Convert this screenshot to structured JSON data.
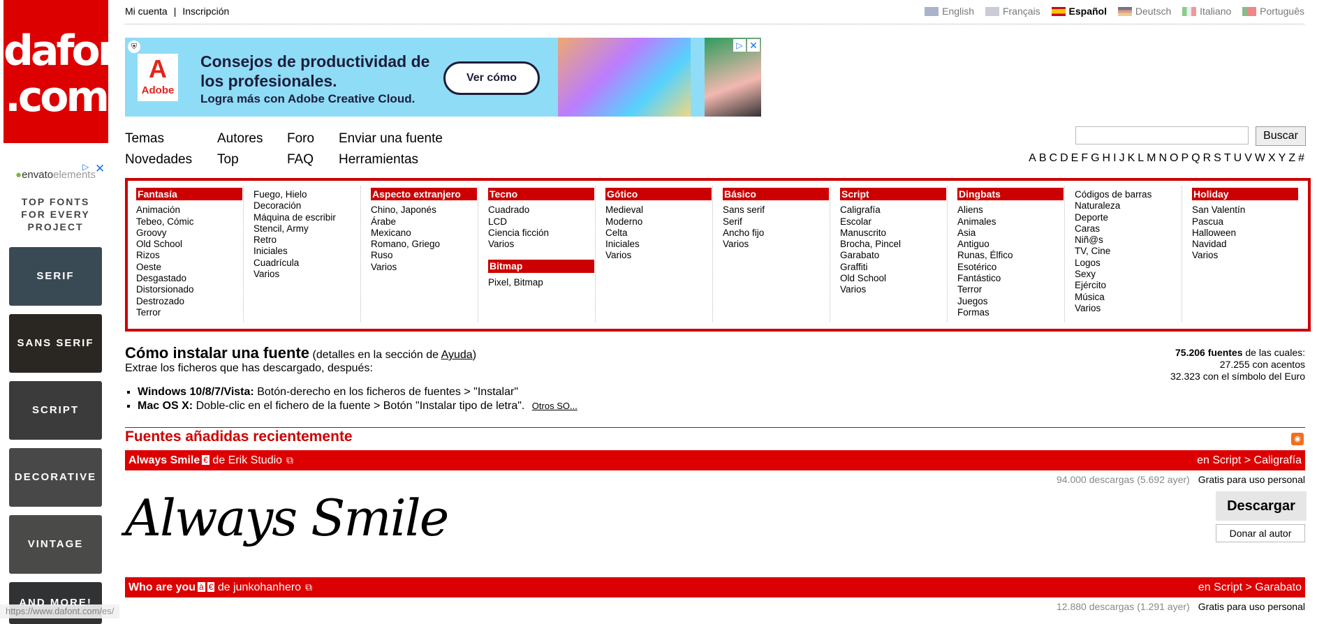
{
  "logo": {
    "line1": "dafont",
    "line2": ".com"
  },
  "envato_ad": {
    "logo_text": "envato",
    "logo_suffix": "elements",
    "tagline": "TOP FONTS FOR EVERY PROJECT",
    "tiles": [
      "SERIF",
      "SANS SERIF",
      "SCRIPT",
      "DECORATIVE",
      "VINTAGE",
      "AND MORE!"
    ],
    "close_glyph": "✕",
    "adchoice_glyph": "▷"
  },
  "toplinks": {
    "account": "Mi cuenta",
    "separator": "|",
    "signup": "Inscripción"
  },
  "languages": [
    {
      "label": "English",
      "active": false,
      "flag": "#a9b3c9"
    },
    {
      "label": "Français",
      "active": false,
      "flag": "#c9ccd6"
    },
    {
      "label": "Español",
      "active": true,
      "flag": "#c60b1e"
    },
    {
      "label": "Deutsch",
      "active": false,
      "flag": "#d9a0a0"
    },
    {
      "label": "Italiano",
      "active": false,
      "flag": "#a7cfa9"
    },
    {
      "label": "Português",
      "active": false,
      "flag": "#9fc79a"
    }
  ],
  "banner_ad": {
    "brand_letter": "A",
    "brand_name": "Adobe",
    "headline": "Consejos de productividad de los profesionales.",
    "subline": "Logra más con Adobe Creative Cloud.",
    "cta": "Ver cómo",
    "close_glyph": "✕",
    "info_glyph": "▷",
    "shield_glyph": "⛨"
  },
  "nav": {
    "themes": "Temas",
    "authors": "Autores",
    "forum": "Foro",
    "submit": "Enviar una fuente",
    "new": "Novedades",
    "top": "Top",
    "faq": "FAQ",
    "tools": "Herramientas"
  },
  "search": {
    "placeholder": "",
    "button": "Buscar"
  },
  "alphabet": [
    "A",
    "B",
    "C",
    "D",
    "E",
    "F",
    "G",
    "H",
    "I",
    "J",
    "K",
    "L",
    "M",
    "N",
    "O",
    "P",
    "Q",
    "R",
    "S",
    "T",
    "U",
    "V",
    "W",
    "X",
    "Y",
    "Z",
    "#"
  ],
  "categories": [
    {
      "head": "Fantasía",
      "items": [
        "Animación",
        "Tebeo, Cómic",
        "Groovy",
        "Old School",
        "Rizos",
        "Oeste",
        "Desgastado",
        "Distorsionado",
        "Destrozado",
        "Terror"
      ]
    },
    {
      "head": "",
      "items": [
        "Fuego, Hielo",
        "Decoración",
        "Máquina de escribir",
        "Stencil, Army",
        "Retro",
        "Iniciales",
        "Cuadrícula",
        "Varios"
      ]
    },
    {
      "head": "Aspecto extranjero",
      "items": [
        "Chino, Japonés",
        "Árabe",
        "Mexicano",
        "Romano, Griego",
        "Ruso",
        "Varios"
      ]
    },
    {
      "head": "Tecno",
      "items": [
        "Cuadrado",
        "LCD",
        "Ciencia ficción",
        "Varios"
      ],
      "head2": "Bitmap",
      "items2": [
        "Pixel, Bitmap"
      ]
    },
    {
      "head": "Gótico",
      "items": [
        "Medieval",
        "Moderno",
        "Celta",
        "Iniciales",
        "Varios"
      ]
    },
    {
      "head": "Básico",
      "items": [
        "Sans serif",
        "Serif",
        "Ancho fijo",
        "Varios"
      ]
    },
    {
      "head": "Script",
      "items": [
        "Caligrafía",
        "Escolar",
        "Manuscrito",
        "Brocha, Pincel",
        "Garabato",
        "Graffiti",
        "Old School",
        "Varios"
      ]
    },
    {
      "head": "Dingbats",
      "items": [
        "Aliens",
        "Animales",
        "Asia",
        "Antiguo",
        "Runas, Élfico",
        "Esotérico",
        "Fantástico",
        "Terror",
        "Juegos",
        "Formas"
      ]
    },
    {
      "head": "",
      "items": [
        "Códigos de barras",
        "Naturaleza",
        "Deporte",
        "Caras",
        "Niñ@s",
        "TV, Cine",
        "Logos",
        "Sexy",
        "Ejército",
        "Música",
        "Varios"
      ]
    },
    {
      "head": "Holiday",
      "items": [
        "San Valentín",
        "Pascua",
        "Halloween",
        "Navidad",
        "Varios"
      ]
    }
  ],
  "install": {
    "title": "Cómo instalar una fuente",
    "detail_pre": "(detalles en la sección de ",
    "detail_link": "Ayuda",
    "detail_post": ")",
    "intro": "Extrae los ficheros que has descargado, después:",
    "windows_label": "Windows 10/8/7/Vista:",
    "windows_text": "Botón-derecho en los ficheros de fuentes > \"Instalar\"",
    "mac_label": "Mac OS X:",
    "mac_text": "Doble-clic en el fichero de la fuente > Botón \"Instalar tipo de letra\".",
    "other_link": "Otros SO..."
  },
  "stats": {
    "total": "75.206 fuentes",
    "total_suffix": " de las cuales:",
    "accents": "27.255 con acentos",
    "euro": "32.323 con el símbolo del Euro"
  },
  "recent": {
    "title": "Fuentes añadidas recientemente",
    "rss_glyph": "◉"
  },
  "fonts": [
    {
      "name": "Always Smile",
      "badges": [
        "€"
      ],
      "by": "de",
      "author": "Erik Studio",
      "ext_glyph": "⧉",
      "category": "en Script > Caligrafía",
      "downloads": "94.000 descargas (5.692 ayer)",
      "license": "Gratis para uso personal",
      "preview": "Always Smile",
      "download_label": "Descargar",
      "donate_label": "Donar al autor"
    },
    {
      "name": "Who are you",
      "badges": [
        "à",
        "€"
      ],
      "by": "de",
      "author": "junkohanhero",
      "ext_glyph": "⧉",
      "category": "en Script > Garabato",
      "downloads": "12.880 descargas (1.291 ayer)",
      "license": "Gratis para uso personal"
    }
  ],
  "status_url": "https://www.dafont.com/es/"
}
